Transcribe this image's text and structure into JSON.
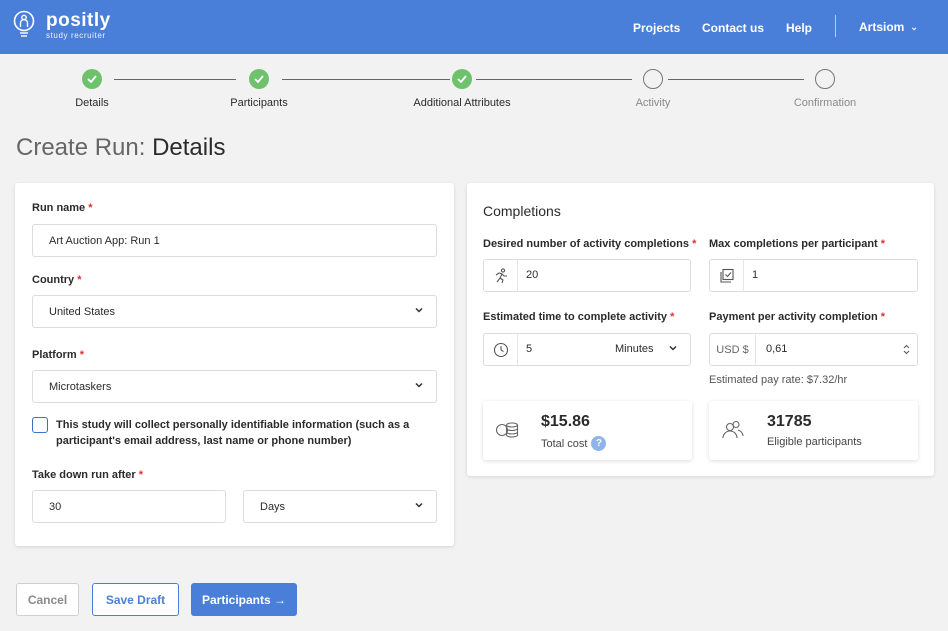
{
  "header": {
    "brand_name": "positly",
    "brand_sub": "study recruiter",
    "nav": [
      "Projects",
      "Contact us",
      "Help"
    ],
    "user": "Artsiom"
  },
  "steps": [
    {
      "label": "Details",
      "state": "done"
    },
    {
      "label": "Participants",
      "state": "done"
    },
    {
      "label": "Additional Attributes",
      "state": "done"
    },
    {
      "label": "Activity",
      "state": "todo"
    },
    {
      "label": "Confirmation",
      "state": "todo"
    }
  ],
  "page_title": {
    "prefix": "Create Run:",
    "name": "Details"
  },
  "details": {
    "run_name_label": "Run name",
    "run_name_value": "Art Auction App: Run 1",
    "country_label": "Country",
    "country_value": "United States",
    "platform_label": "Platform",
    "platform_value": "Microtaskers",
    "pii_text": "This study will collect personally identifiable information (such as a participant's email address, last name or phone number)",
    "takedown_label": "Take down run after",
    "takedown_value": "30",
    "takedown_unit": "Days",
    "required_mark": "*"
  },
  "completions": {
    "title": "Completions",
    "desired_label": "Desired number of activity completions",
    "desired_value": "20",
    "max_label": "Max completions per participant",
    "max_value": "1",
    "time_label": "Estimated time to complete activity",
    "time_value": "5",
    "time_unit": "Minutes",
    "payment_label": "Payment per activity completion",
    "payment_currency": "USD $",
    "payment_value": "0,61",
    "pay_rate": "Estimated pay rate: $7.32/hr",
    "total_cost_value": "$15.86",
    "total_cost_label": "Total cost",
    "help_glyph": "?",
    "eligible_value": "31785",
    "eligible_label": "Eligible participants"
  },
  "buttons": {
    "cancel": "Cancel",
    "save_draft": "Save Draft",
    "next": "Participants →"
  },
  "colors": {
    "brand": "#4a7fd9",
    "success": "#6ec26b",
    "required": "#e03131"
  }
}
